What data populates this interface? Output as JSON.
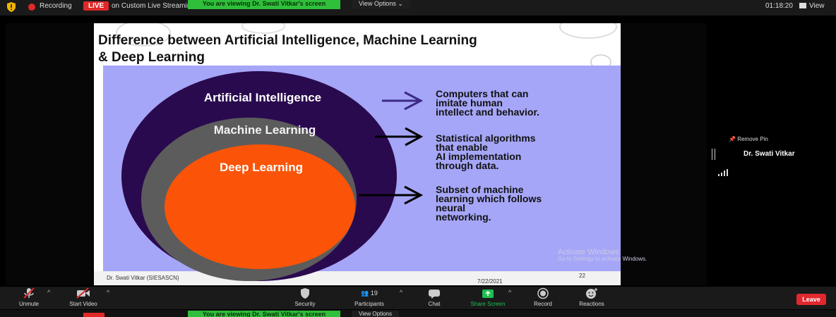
{
  "top_bar": {
    "recording_label": "Recording",
    "live_badge": "LIVE",
    "stream_label": "on Custom Live Streaming Service",
    "viewing_banner": "You are viewing Dr. Swati Vitkar's screen",
    "view_options": "View Options",
    "timer": "01:18:20",
    "view_label": "View"
  },
  "slide": {
    "title_line1": "Difference between Artificial Intelligence, Machine Learning",
    "title_line2": "& Deep Learning",
    "circles": {
      "ai": "Artificial Intelligence",
      "ml": "Machine Learning",
      "dl": "Deep Learning"
    },
    "descriptions": {
      "ai": [
        "Computers that can",
        "imitate human",
        "intellect and behavior."
      ],
      "ml": [
        "Statistical algorithms",
        "that enable",
        "AI implementation",
        "through data."
      ],
      "dl": [
        "Subset of machine",
        "learning which follows",
        "neural",
        "networking."
      ]
    },
    "footer": {
      "author": "Dr. Swati Vitkar (SIESASCN)",
      "date": "7/22/2021",
      "page": "22"
    },
    "watermark": {
      "title": "Activate Windows",
      "subtitle": "Go to Settings to activate Windows."
    }
  },
  "side_panel": {
    "remove_pin": "Remove Pin",
    "participant_name": "Dr. Swati Vitkar"
  },
  "toolbar": {
    "unmute": "Unmute",
    "start_video": "Start Video",
    "security": "Security",
    "participants": "Participants",
    "participant_count": "19",
    "chat": "Chat",
    "share_screen": "Share Screen",
    "record": "Record",
    "reactions": "Reactions",
    "leave": "Leave"
  },
  "colors": {
    "live_red": "#e02828",
    "banner_green": "#2fbf3a",
    "panel_lavender": "#a6a6f8",
    "ai_purple": "#2a0a4e",
    "ml_gray": "#5c5c5c",
    "dl_orange": "#fb5408",
    "share_green": "#1fbf52"
  }
}
